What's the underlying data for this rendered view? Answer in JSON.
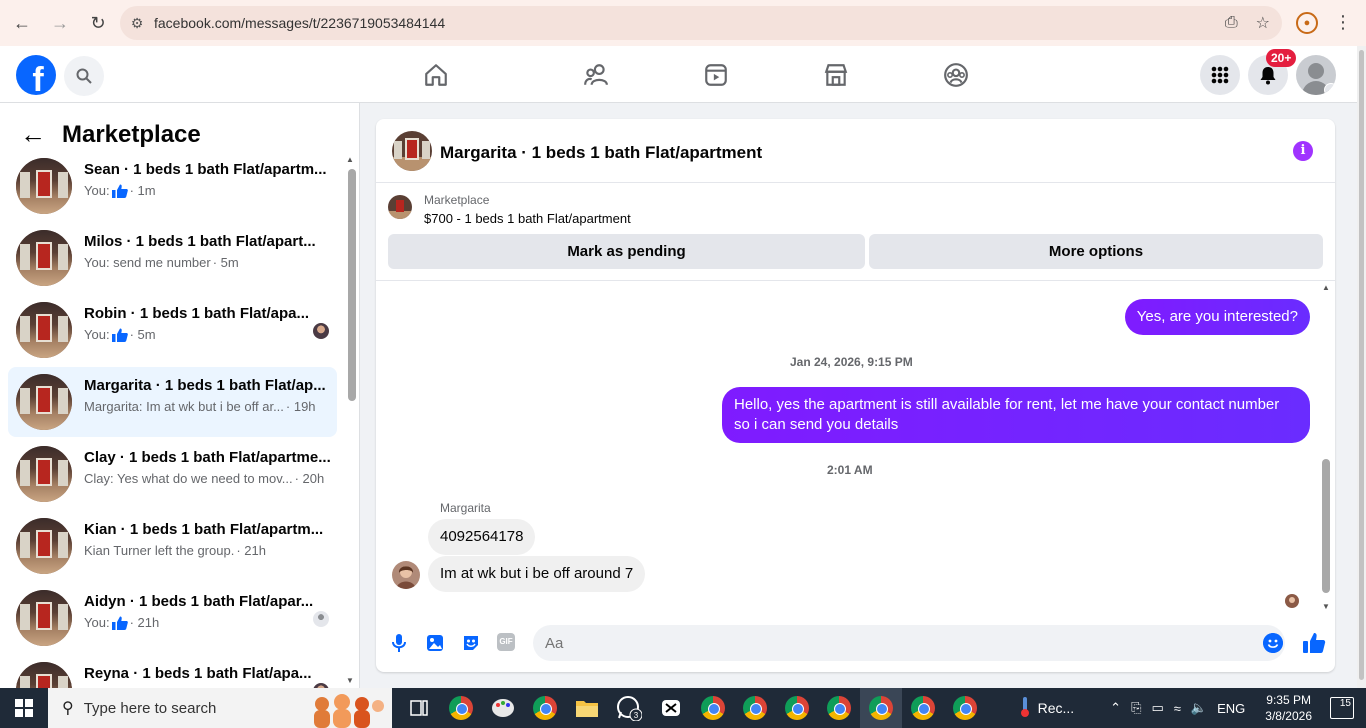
{
  "browser": {
    "url": "facebook.com/messages/t/2236719053484144"
  },
  "header": {
    "notif_count": "20+"
  },
  "sidebar": {
    "title": "Marketplace",
    "conversations": [
      {
        "name": "Sean · 1 beds 1 bath Flat/apartm...",
        "preview": "You:",
        "time": "· 1m",
        "like": true,
        "mini": ""
      },
      {
        "name": "Milos · 1 beds 1 bath Flat/apart...",
        "preview": "You: send me number",
        "time": "· 5m",
        "like": false,
        "mini": ""
      },
      {
        "name": "Robin · 1 beds 1 bath Flat/apa...",
        "preview": "You:",
        "time": "· 5m",
        "like": true,
        "mini": "photo"
      },
      {
        "name": "Margarita · 1 beds 1 bath Flat/ap...",
        "preview": "Margarita: Im at wk but i be off ar...",
        "time": "· 19h",
        "like": false,
        "mini": ""
      },
      {
        "name": "Clay · 1 beds 1 bath Flat/apartme...",
        "preview": "Clay: Yes what do we need to mov...",
        "time": "· 20h",
        "like": false,
        "mini": ""
      },
      {
        "name": "Kian · 1 beds 1 bath Flat/apartm...",
        "preview": "Kian Turner left the group.",
        "time": "· 21h",
        "like": false,
        "mini": ""
      },
      {
        "name": "Aidyn · 1 beds 1 bath Flat/apar...",
        "preview": "You:",
        "time": "· 21h",
        "like": true,
        "mini": "default"
      },
      {
        "name": "Reyna · 1 beds 1 bath Flat/apa...",
        "preview": "",
        "time": "",
        "like": false,
        "mini": "photo"
      }
    ]
  },
  "chat": {
    "title": "Margarita · 1 beds 1 bath Flat/apartment",
    "listing_category": "Marketplace",
    "listing_price": "$700 - 1 beds 1 bath Flat/apartment",
    "btn_pending": "Mark as pending",
    "btn_more": "More options",
    "messages": {
      "out1": "Yes, are you interested?",
      "ts1": "Jan 24, 2026, 9:15 PM",
      "out2": "Hello, yes the apartment is still available for rent, let me have your contact number so i can send you details",
      "ts2": "2:01 AM",
      "sender": "Margarita",
      "in1": "4092564178",
      "in2": "Im at wk but i be off around 7"
    },
    "composer_placeholder": "Aa"
  },
  "taskbar": {
    "search_placeholder": "Type here to search",
    "rec_label": "Rec...",
    "lang": "ENG",
    "time": "9:35 PM",
    "date": "3/8/2026",
    "notif": "15",
    "whatsapp_badge": "3"
  },
  "colors": {
    "fb_blue": "#0866ff",
    "messenger_purple": "#7f1bff",
    "active_row": "#ebf5ff",
    "notif_red": "#e41e3f"
  }
}
